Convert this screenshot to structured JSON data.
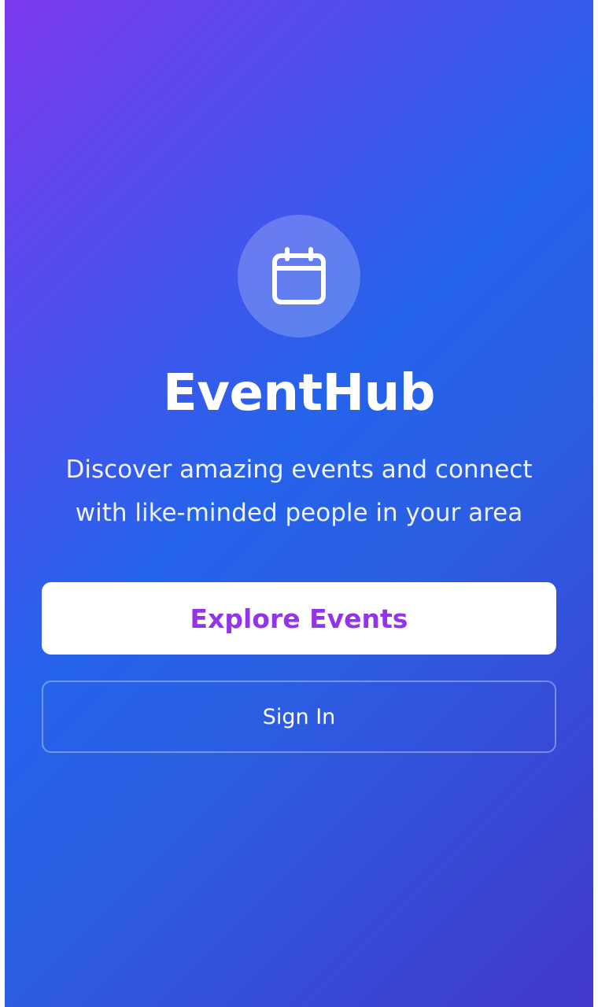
{
  "app": {
    "name": "EventHub",
    "tagline": "Discover amazing events and connect with like-minded people in your area",
    "logo_icon": "calendar-icon"
  },
  "actions": {
    "primary_label": "Explore Events",
    "secondary_label": "Sign In"
  },
  "colors": {
    "gradient_start": "#7c3aed",
    "gradient_mid": "#2563eb",
    "gradient_end": "#4338ca",
    "primary_button_text": "#9333ea",
    "primary_button_bg": "#ffffff"
  }
}
